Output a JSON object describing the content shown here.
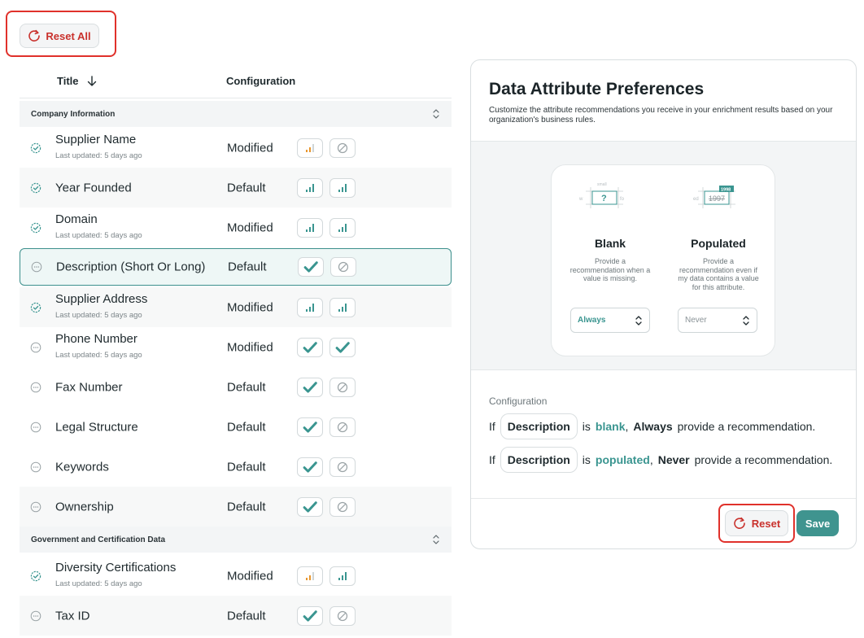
{
  "toolbar": {
    "reset_all_label": "Reset All"
  },
  "table": {
    "col_title": "Title",
    "col_configuration": "Configuration",
    "groups": [
      "Company Information",
      "Government and Certification Data"
    ],
    "rows": [
      {
        "name": "Supplier Name",
        "updated": "Last updated: 5 days ago",
        "config": "Modified",
        "status": "check",
        "chips": [
          "bars-orange",
          "blocked"
        ]
      },
      {
        "name": "Year Founded",
        "updated": "",
        "config": "Default",
        "status": "check",
        "chips": [
          "bars-teal",
          "bars-teal"
        ]
      },
      {
        "name": "Domain",
        "updated": "Last updated: 5 days ago",
        "config": "Modified",
        "status": "check",
        "chips": [
          "bars-teal",
          "bars-teal"
        ]
      },
      {
        "name": "Description (Short Or Long)",
        "updated": "",
        "config": "Default",
        "status": "pending",
        "chips": [
          "check",
          "blocked"
        ]
      },
      {
        "name": "Supplier Address",
        "updated": "Last updated: 5 days ago",
        "config": "Modified",
        "status": "check",
        "chips": [
          "bars-teal",
          "bars-teal"
        ]
      },
      {
        "name": "Phone Number",
        "updated": "Last updated: 5 days ago",
        "config": "Modified",
        "status": "pending",
        "chips": [
          "check",
          "check"
        ]
      },
      {
        "name": "Fax Number",
        "updated": "",
        "config": "Default",
        "status": "pending",
        "chips": [
          "check",
          "blocked"
        ]
      },
      {
        "name": "Legal Structure",
        "updated": "",
        "config": "Default",
        "status": "pending",
        "chips": [
          "check",
          "blocked"
        ]
      },
      {
        "name": "Keywords",
        "updated": "",
        "config": "Default",
        "status": "pending",
        "chips": [
          "check",
          "blocked"
        ]
      },
      {
        "name": "Ownership",
        "updated": "",
        "config": "Default",
        "status": "pending",
        "chips": [
          "check",
          "blocked"
        ]
      },
      {
        "name": "Diversity Certifications",
        "updated": "Last updated: 5 days ago",
        "config": "Modified",
        "status": "check",
        "chips": [
          "bars-orange",
          "bars-teal"
        ]
      },
      {
        "name": "Tax ID",
        "updated": "",
        "config": "Default",
        "status": "pending",
        "chips": [
          "check",
          "blocked"
        ]
      }
    ]
  },
  "panel": {
    "title": "Data Attribute Preferences",
    "description": "Customize the attribute recommendations you receive in your enrichment results based on your organization's business rules.",
    "blank": {
      "heading": "Blank",
      "desc": "Provide a recommendation when a value is missing.",
      "select_value": "Always",
      "illus_mark": "?",
      "illus_top": "small",
      "illus_left": "w",
      "illus_right": "fo"
    },
    "populated": {
      "heading": "Populated",
      "desc": "Provide a recommendation even if my data contains a value for this attribute.",
      "select_value": "Never",
      "illus_new": "1998",
      "illus_old": "1997",
      "illus_left": "ed"
    },
    "config_label": "Configuration",
    "sentence1": {
      "if": "If",
      "attr": "Description",
      "is": "is",
      "state": "blank",
      "comma": ",",
      "mode": "Always",
      "rest": "provide a recommendation."
    },
    "sentence2": {
      "if": "If",
      "attr": "Description",
      "is": "is",
      "state": "populated",
      "comma": ",",
      "mode": "Never",
      "rest": "provide a recommendation."
    },
    "reset_label": "Reset",
    "save_label": "Save"
  },
  "colors": {
    "accent": "#3f948f",
    "danger": "#e0312b",
    "orange": "#e8962e"
  }
}
